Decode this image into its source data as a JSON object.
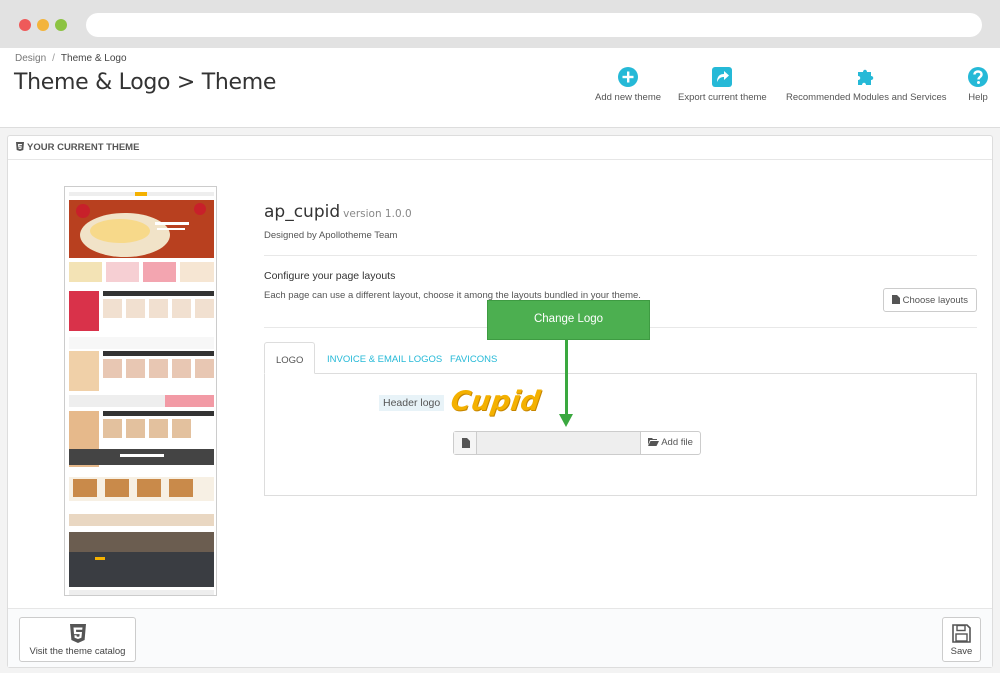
{
  "breadcrumb": {
    "parent": "Design",
    "separator": "/",
    "current": "Theme & Logo"
  },
  "page_title": "Theme & Logo > Theme",
  "toolbar": {
    "add_new_theme": "Add new theme",
    "export_current_theme": "Export current theme",
    "recommended": "Recommended Modules and Services",
    "help": "Help"
  },
  "panel": {
    "heading": "YOUR CURRENT THEME",
    "theme_name": "ap_cupid",
    "theme_version": "version 1.0.0",
    "designed_by": "Designed by Apollotheme Team",
    "config_title": "Configure your page layouts",
    "config_desc": "Each page can use a different layout, choose it among the layouts bundled in your theme.",
    "choose_layouts": "Choose layouts"
  },
  "tabs": [
    {
      "label": "LOGO"
    },
    {
      "label": "INVOICE & EMAIL LOGOS"
    },
    {
      "label": "FAVICONS"
    }
  ],
  "logo_tab": {
    "header_logo_label": "Header logo",
    "logo_text": "Cupid",
    "add_file": "Add file"
  },
  "callout": {
    "label": "Change Logo"
  },
  "footer": {
    "catalog_button": "Visit the theme catalog",
    "save_button": "Save"
  },
  "colors": {
    "accent": "#25b9d7",
    "callout": "#4caf50",
    "logo": "#f4b100"
  }
}
